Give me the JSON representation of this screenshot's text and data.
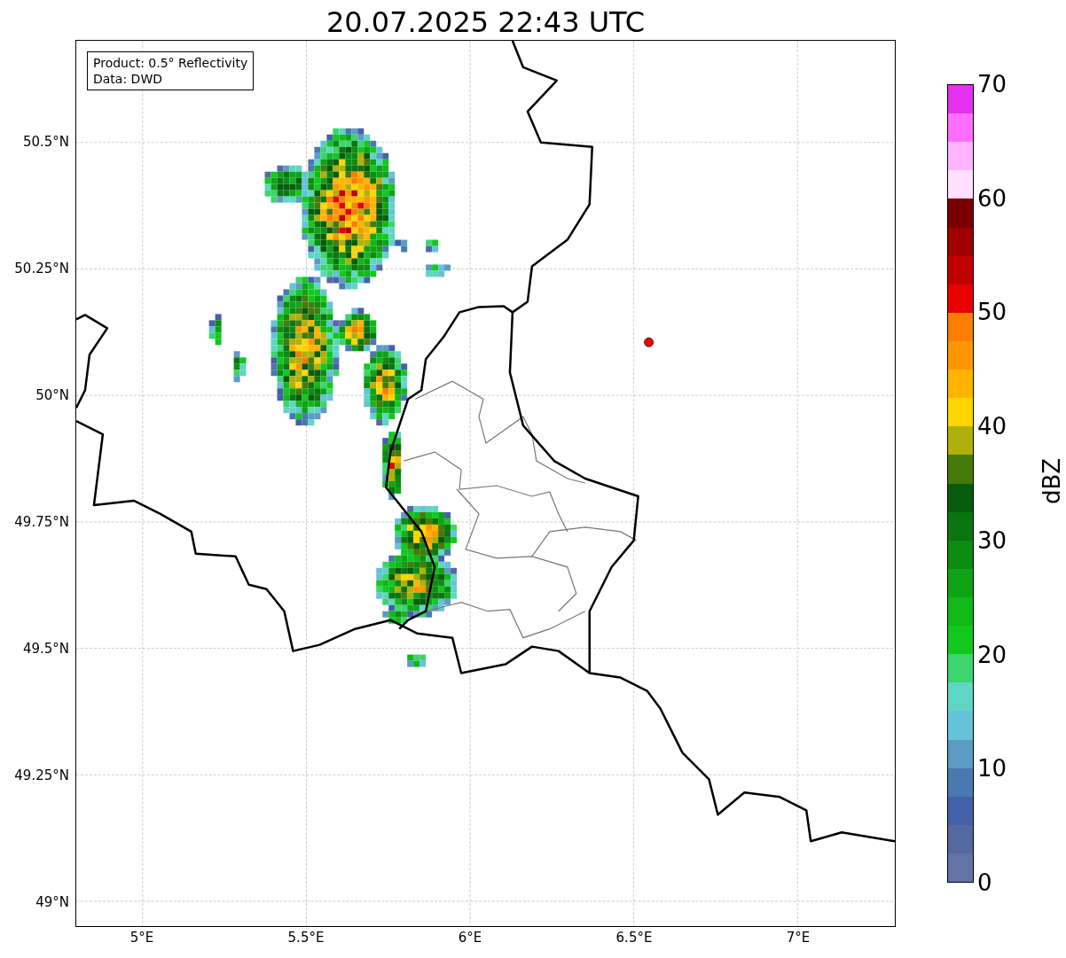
{
  "title": "20.07.2025 22:43 UTC",
  "legend": [
    "Product: 0.5° Reflectivity",
    "Data: DWD"
  ],
  "y_ticks": [
    "50.5°N",
    "50.25°N",
    "50°N",
    "49.75°N",
    "49.5°N",
    "49.25°N",
    "49°N"
  ],
  "x_ticks": [
    "5°E",
    "5.5°E",
    "6°E",
    "6.5°E",
    "7°E"
  ],
  "colorbar": {
    "label": "dBZ",
    "ticks": [
      "70",
      "60",
      "50",
      "40",
      "30",
      "20",
      "10",
      "0"
    ],
    "levels": [
      {
        "color": "#e632f0"
      },
      {
        "color": "#ff6eff"
      },
      {
        "color": "#ffb4ff"
      },
      {
        "color": "#ffe0ff"
      },
      {
        "color": "#7a0000"
      },
      {
        "color": "#a00000"
      },
      {
        "color": "#c00000"
      },
      {
        "color": "#e60000"
      },
      {
        "color": "#ff7d00"
      },
      {
        "color": "#ff9600"
      },
      {
        "color": "#ffb400"
      },
      {
        "color": "#ffd500"
      },
      {
        "color": "#afb00a"
      },
      {
        "color": "#467a0b"
      },
      {
        "color": "#075c0b"
      },
      {
        "color": "#0b7510"
      },
      {
        "color": "#0c8c12"
      },
      {
        "color": "#0ea316"
      },
      {
        "color": "#10b818"
      },
      {
        "color": "#11c81f"
      },
      {
        "color": "#3cd46e"
      },
      {
        "color": "#5fd6c4"
      },
      {
        "color": "#66c2d9"
      },
      {
        "color": "#5b9bc4"
      },
      {
        "color": "#4a78b0"
      },
      {
        "color": "#4460a8"
      },
      {
        "color": "#5568a0"
      },
      {
        "color": "#6473a6"
      }
    ]
  }
}
